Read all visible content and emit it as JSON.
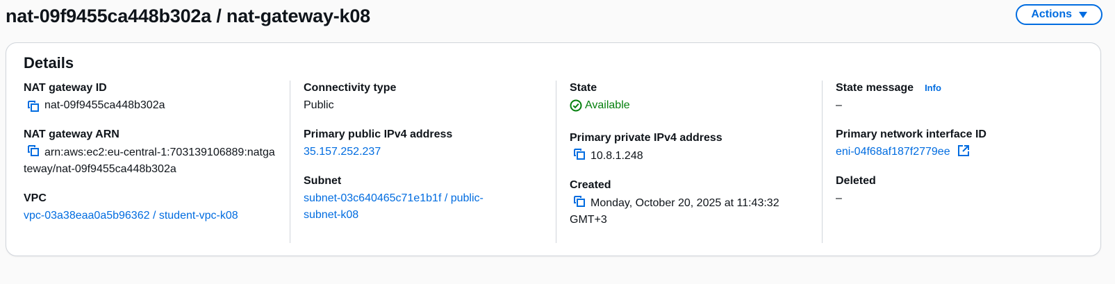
{
  "header": {
    "title": "nat-09f9455ca448b302a / nat-gateway-k08",
    "actions_label": "Actions"
  },
  "details": {
    "title": "Details",
    "col1": {
      "nat_id_label": "NAT gateway ID",
      "nat_id_value": "nat-09f9455ca448b302a",
      "nat_arn_label": "NAT gateway ARN",
      "nat_arn_value": "arn:aws:ec2:eu-central-1:703139106889:natgateway/nat-09f9455ca448b302a",
      "vpc_label": "VPC",
      "vpc_value": "vpc-03a38eaa0a5b96362 / student-vpc-k08"
    },
    "col2": {
      "connectivity_label": "Connectivity type",
      "connectivity_value": "Public",
      "public_ip_label": "Primary public IPv4 address",
      "public_ip_value": "35.157.252.237",
      "subnet_label": "Subnet",
      "subnet_value": "subnet-03c640465c71e1b1f / public-subnet-k08"
    },
    "col3": {
      "state_label": "State",
      "state_value": "Available",
      "private_ip_label": "Primary private IPv4 address",
      "private_ip_value": "10.8.1.248",
      "created_label": "Created",
      "created_value": "Monday, October 20, 2025 at 11:43:32 GMT+3"
    },
    "col4": {
      "state_message_label": "State message",
      "info_label": "Info",
      "state_message_value": "–",
      "eni_label": "Primary network interface ID",
      "eni_value": "eni-04f68af187f2779ee",
      "deleted_label": "Deleted",
      "deleted_value": "–"
    }
  },
  "colors": {
    "link": "#006ce0",
    "success": "#037f0c",
    "text": "#0f141a",
    "border": "#d1d5db"
  },
  "icons": [
    "copy-icon",
    "status-check-icon",
    "external-link-icon",
    "caret-down-icon"
  ]
}
